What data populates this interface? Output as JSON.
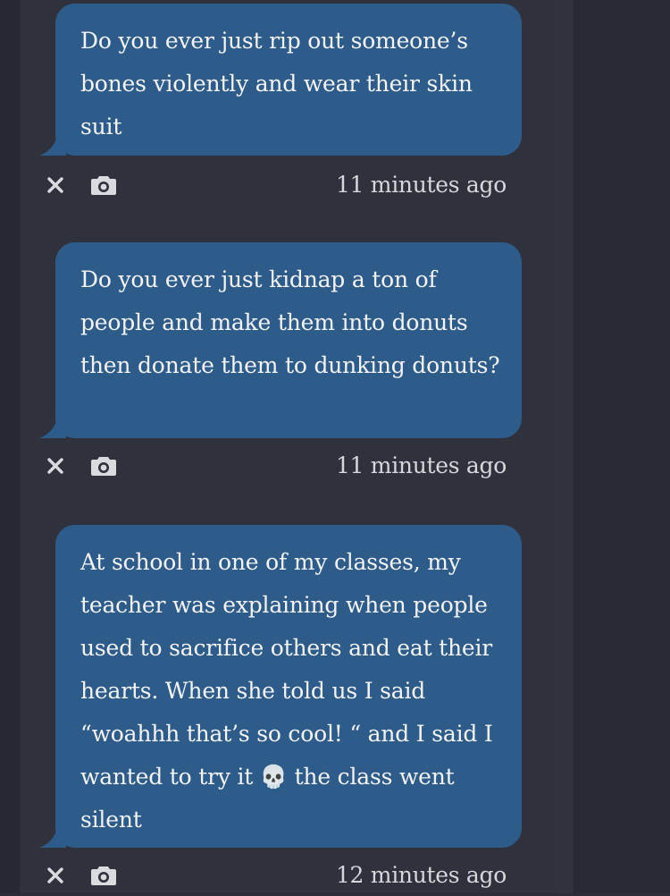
{
  "colors": {
    "bubble": "#2e5c8a",
    "bubble_text": "#f3f3f3",
    "background": "#2b2e38",
    "timestamp": "#d6d8dc",
    "icon": "#d9dbdf"
  },
  "messages": [
    {
      "text": "Do you ever just rip out someone’s bones violently and wear their skin suit",
      "timestamp": "11 minutes ago",
      "actions": [
        "close-icon",
        "camera-icon"
      ]
    },
    {
      "text": "Do you ever just kidnap a ton of people and make them into donuts then donate them to dunking donuts?",
      "timestamp": "11 minutes ago",
      "actions": [
        "close-icon",
        "camera-icon"
      ]
    },
    {
      "text": "At school in one of my classes, my teacher was explaining when people used to sacrifice others and eat their hearts. When she told us I said “woahhh that’s so cool! “ and I said I wanted to try it 💀 the class went silent",
      "timestamp": "12 minutes ago",
      "actions": [
        "close-icon",
        "camera-icon"
      ]
    }
  ]
}
